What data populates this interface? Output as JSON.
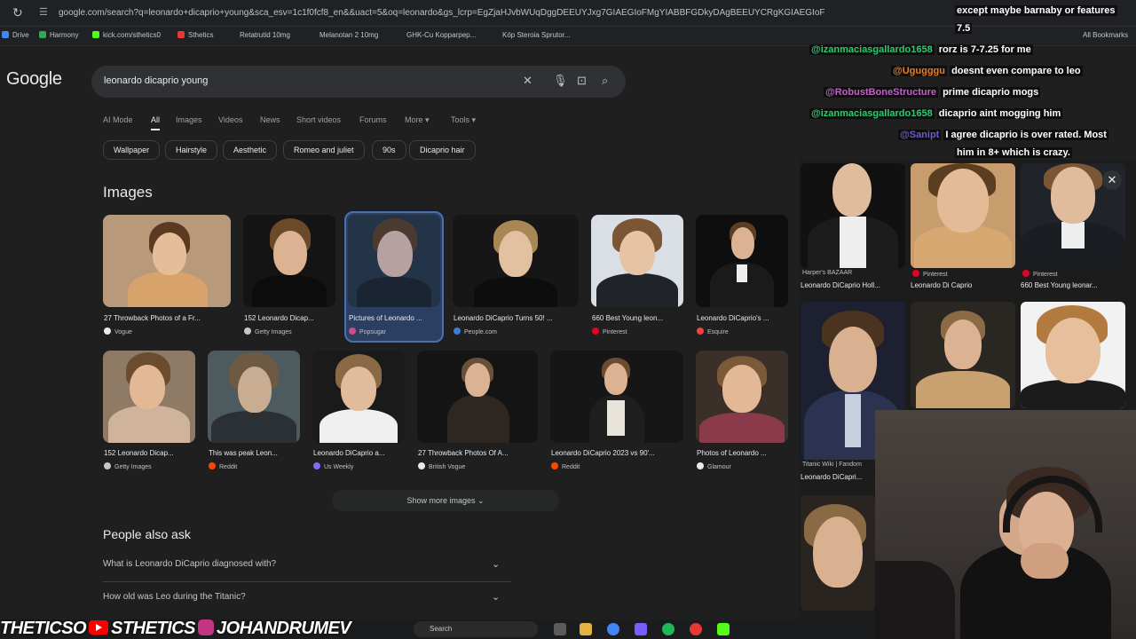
{
  "browser": {
    "url": "google.com/search?q=leonardo+dicaprio+young&sca_esv=1c1f0fcf8_en&&uact=5&oq=leonardo&gs_lcrp=EgZjaHJvbWUqDggDEEUYJxg7GIAEGIoFMgYIABBFGDkyDAgBEEUYCRgKGIAEGIoF",
    "bookmarks": [
      "Drive",
      "Harmony",
      "kick.com/sthetics0",
      "Sthetics",
      "Retatrutid 10mg",
      "Melanotan 2 10mg",
      "GHK-Cu Kopparpep...",
      "Köp Steroia Sprutor...",
      "All Bookmarks"
    ]
  },
  "google": {
    "logo": "Google",
    "query": "leonardo dicaprio young",
    "tabs": [
      "AI Mode",
      "All",
      "Images",
      "Videos",
      "News",
      "Short videos",
      "Forums",
      "More ▾",
      "Tools ▾"
    ],
    "active_tab": "All",
    "chips": [
      "Wallpaper",
      "Hairstyle",
      "Aesthetic",
      "Romeo and juliet",
      "90s",
      "Dicaprio hair"
    ],
    "images_heading": "Images",
    "images_row1": [
      {
        "caption": "27 Throwback Photos of a Fr...",
        "source": "Vogue",
        "fav": "#e8eaed"
      },
      {
        "caption": "152 Leonardo Dicap...",
        "source": "Getty Images",
        "fav": "#c4c7c5"
      },
      {
        "caption": "Pictures of Leonardo ...",
        "source": "Popsugar",
        "fav": "#d04a8a"
      },
      {
        "caption": "Leonardo DiCaprio Turns 50! ...",
        "source": "People.com",
        "fav": "#3d7bd6"
      },
      {
        "caption": "660 Best Young leon...",
        "source": "Pinterest",
        "fav": "#e60023"
      },
      {
        "caption": "Leonardo DiCaprio's ...",
        "source": "Esquire",
        "fav": "#e44"
      }
    ],
    "images_row2": [
      {
        "caption": "152 Leonardo Dicap...",
        "source": "Getty Images",
        "fav": "#c4c7c5"
      },
      {
        "caption": "This was peak Leon...",
        "source": "Reddit",
        "fav": "#ff4500"
      },
      {
        "caption": "Leonardo DiCaprio a...",
        "source": "Us Weekly",
        "fav": "#7b6cff"
      },
      {
        "caption": "27 Throwback Photos Of A...",
        "source": "British Vogue",
        "fav": "#e8eaed"
      },
      {
        "caption": "Leonardo DiCaprio 2023 vs 90'...",
        "source": "Reddit",
        "fav": "#ff4500"
      },
      {
        "caption": "Photos of Leonardo ...",
        "source": "Glamour",
        "fav": "#e8eaed"
      }
    ],
    "show_more": "Show more images  ⌄",
    "paa_title": "People also ask",
    "paa": [
      "What is Leonardo DiCaprio diagnosed with?",
      "How old was Leo during the Titanic?"
    ]
  },
  "side_panel": {
    "items": [
      {
        "caption": "Leonardo DiCaprio Holl...",
        "source": "Harper's BAZAAR"
      },
      {
        "caption": "Leonardo Di Caprio",
        "source": "Pinterest"
      },
      {
        "caption": "660 Best Young leonar...",
        "source": "Pinterest"
      },
      {
        "caption": "Leonardo DiCapri...",
        "source": "Titanic Wiki | Fandom"
      }
    ]
  },
  "chat": [
    {
      "user": "",
      "msg": "except maybe barnaby or features",
      "color": "#ffffff"
    },
    {
      "user": "",
      "msg": "7.5",
      "color": "#ffffff"
    },
    {
      "user": "@izanmaciasgallardo1658",
      "msg": "rorz is 7-7.25 for me",
      "color": "#2ecc71"
    },
    {
      "user": "@Ugugggu",
      "msg": "doesnt even compare to leo",
      "color": "#e67e22"
    },
    {
      "user": "@RobustBoneStructure",
      "msg": "prime dicaprio mogs",
      "color": "#c061cb"
    },
    {
      "user": "@izanmaciasgallardo1658",
      "msg": "dicaprio aint mogging him",
      "color": "#2ecc71"
    },
    {
      "user": "@Sanipt",
      "msg": "I agree dicaprio is over rated. Most",
      "color": "#6a5acd"
    },
    {
      "user": "",
      "msg": "him in 8+ which is crazy.",
      "color": "#ffffff"
    }
  ],
  "watermark": {
    "part1": "THETICSO",
    "part2": "STHETICS",
    "part3": "JOHANDRUMEV"
  },
  "taskbar": {
    "search": "Search"
  }
}
